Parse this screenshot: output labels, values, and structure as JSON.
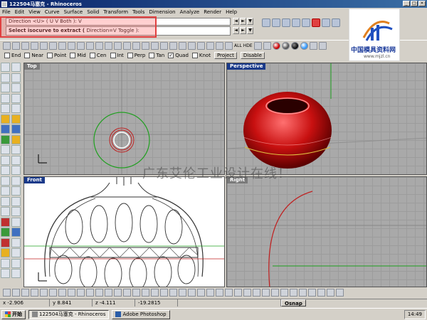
{
  "window": {
    "title": "122504马塞克 - Rhinoceros"
  },
  "menu": [
    "File",
    "Edit",
    "View",
    "Curve",
    "Surface",
    "Solid",
    "Transform",
    "Tools",
    "Dimension",
    "Analyze",
    "Render",
    "Help"
  ],
  "command": {
    "history": "Direction <U> ( U  V  Both ): V",
    "prompt": "Select isocurve to extract ( ",
    "prompt_options": "Direction=V  Toggle ):"
  },
  "toolbar2": {
    "labels": [
      "ALL",
      "HDE"
    ]
  },
  "osnap": {
    "items": [
      {
        "label": "End",
        "checked": false
      },
      {
        "label": "Near",
        "checked": false
      },
      {
        "label": "Point",
        "checked": false
      },
      {
        "label": "Mid",
        "checked": false
      },
      {
        "label": "Cen",
        "checked": false
      },
      {
        "label": "Int",
        "checked": false
      },
      {
        "label": "Perp",
        "checked": false
      },
      {
        "label": "Tan",
        "checked": false
      },
      {
        "label": "Quad",
        "checked": true
      },
      {
        "label": "Knot",
        "checked": false
      }
    ],
    "project_label": "Project",
    "disable_label": "Disable"
  },
  "viewports": {
    "top": {
      "label": "Top"
    },
    "perspective": {
      "label": "Perspective"
    },
    "front": {
      "label": "Front"
    },
    "right": {
      "label": "Right"
    }
  },
  "watermark": {
    "text": "广东艾伦工业设计在线！"
  },
  "logo": {
    "text": "中国模具资料网",
    "url": "www.mjzl.cn"
  },
  "status": {
    "x": "x -2.906",
    "y": "y 8.841",
    "z": "z -4.111",
    "w": "-19.2815",
    "osnap": "Osnap"
  },
  "taskbar": {
    "start": "开始",
    "tasks": [
      {
        "label": "122504马塞克 - Rhinoceros",
        "active": true
      },
      {
        "label": "Adobe Photoshop",
        "active": false
      }
    ],
    "clock": "14:49"
  },
  "colors": {
    "title_bar": "#0a246a",
    "highlight_box": "#e04040",
    "viewport_grid": "#a9a9a9",
    "sphere": "#c81010",
    "isocurve_green": "#20a020",
    "isocurve_red": "#c02020"
  }
}
